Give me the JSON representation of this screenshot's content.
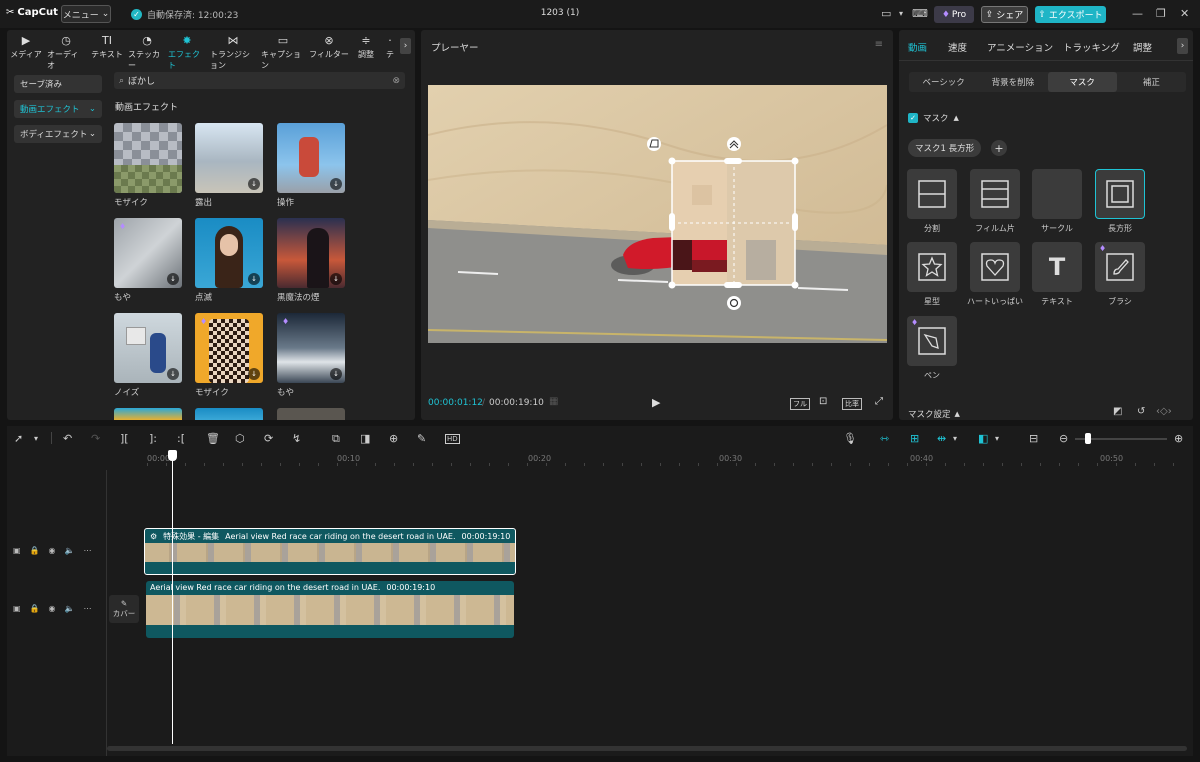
{
  "app": {
    "name": "CapCut",
    "menu_label": "メニュー",
    "autosave": "自動保存済: 12:00:23",
    "project_title": "1203 (1)",
    "pro_label": "Pro",
    "share_label": "シェア",
    "export_label": "エクスポート"
  },
  "left_tabs": [
    {
      "label": "メディア",
      "icon": "media-icon"
    },
    {
      "label": "オーディオ",
      "icon": "audio-icon"
    },
    {
      "label": "テキスト",
      "icon": "text-icon"
    },
    {
      "label": "ステッカー",
      "icon": "sticker-icon"
    },
    {
      "label": "エフェクト",
      "icon": "effects-icon"
    },
    {
      "label": "トランジション",
      "icon": "transition-icon"
    },
    {
      "label": "キャプション",
      "icon": "caption-icon"
    },
    {
      "label": "フィルター",
      "icon": "filter-icon"
    },
    {
      "label": "調整",
      "icon": "adjust-icon"
    },
    {
      "label": "テ",
      "icon": "template-icon"
    }
  ],
  "sidebar": {
    "saved": "セーブ済み",
    "video_effects": "動画エフェクト",
    "body_effects": "ボディエフェクト"
  },
  "search": {
    "value": "ぼかし"
  },
  "effects_section_title": "動画エフェクト",
  "effects": [
    {
      "label": "モザイク"
    },
    {
      "label": "露出"
    },
    {
      "label": "操作"
    },
    {
      "label": "もや"
    },
    {
      "label": "点滅"
    },
    {
      "label": "黒魔法の煙"
    },
    {
      "label": "ノイズ"
    },
    {
      "label": "モザイク"
    },
    {
      "label": "もや"
    }
  ],
  "player": {
    "title": "プレーヤー",
    "current_time": "00:00:01:12",
    "total_time": "00:00:19:10",
    "full_label": "フル",
    "ratio_label": "比率"
  },
  "right_tabs": [
    "動画",
    "速度",
    "アニメーション",
    "トラッキング",
    "調整"
  ],
  "sub_tabs": [
    "ベーシック",
    "背景を削除",
    "マスク",
    "補正"
  ],
  "mask": {
    "section_label": "マスク",
    "chip_label": "マスク1 長方形",
    "settings_label": "マスク設定",
    "tiles": [
      "分割",
      "フィルム片",
      "サークル",
      "長方形",
      "星型",
      "ハートいっぱい",
      "テキスト",
      "ブラシ",
      "ペン"
    ]
  },
  "timeline": {
    "ruler": [
      "00:00",
      "00:10",
      "00:20",
      "00:30",
      "00:40",
      "00:50"
    ],
    "effect_clip": {
      "tag": "特殊効果 - 編集",
      "title": "Aerial view Red race car riding on the desert road in UAE.",
      "duration": "00:00:19:10"
    },
    "main_clip": {
      "title": "Aerial view Red race car riding on the desert road in UAE.",
      "duration": "00:00:19:10"
    },
    "cover_label": "カバー"
  }
}
